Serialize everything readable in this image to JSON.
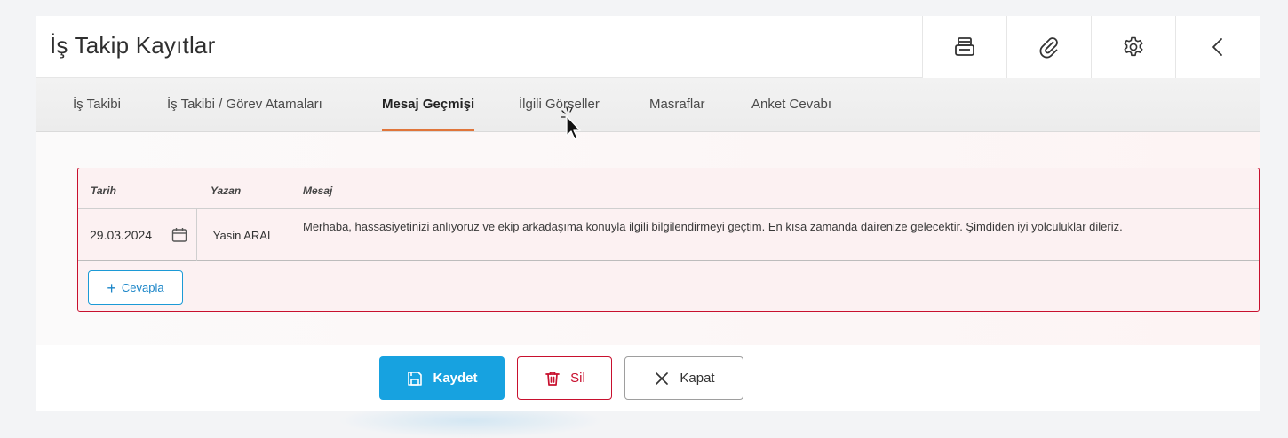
{
  "header": {
    "title": "İş Takip Kayıtlar",
    "toolbar": [
      {
        "icon": "printer-icon"
      },
      {
        "icon": "paperclip-icon"
      },
      {
        "icon": "gear-icon"
      },
      {
        "icon": "chevron-left-icon"
      }
    ]
  },
  "tabs": [
    {
      "label": "İş Takibi",
      "active": false
    },
    {
      "label": "İş Takibi / Görev Atamaları",
      "active": false
    },
    {
      "label": "Mesaj Geçmişi",
      "active": true
    },
    {
      "label": "İlgili Görseller",
      "active": false
    },
    {
      "label": "Masraflar",
      "active": false
    },
    {
      "label": "Anket Cevabı",
      "active": false
    }
  ],
  "grid": {
    "columns": [
      "Tarih",
      "Yazan",
      "Mesaj"
    ],
    "rows": [
      {
        "date": "29.03.2024",
        "author": "Yasin ARAL",
        "message": "Merhaba, hassasiyetinizi anlıyoruz ve ekip arkadaşıma konuyla ilgili bilgilendirmeyi geçtim. En kısa zamanda dairenize gelecektir. Şimdiden iyi yolculuklar dileriz."
      }
    ],
    "reply_label": "Cevapla"
  },
  "footer": {
    "save_label": "Kaydet",
    "delete_label": "Sil",
    "close_label": "Kapat"
  },
  "colors": {
    "accent_tab": "#e0753a",
    "primary": "#17a2e0",
    "danger": "#c8102e"
  }
}
